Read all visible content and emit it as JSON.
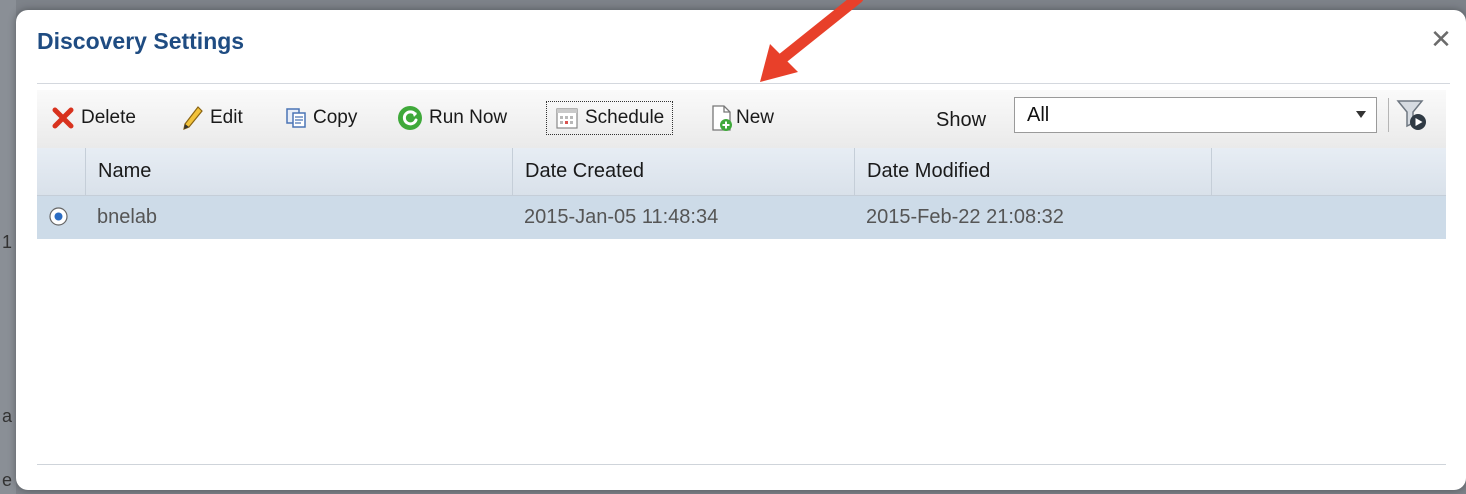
{
  "backdrop": {
    "glyphs": [
      "1",
      "a",
      "e"
    ]
  },
  "dialog": {
    "title": "Discovery Settings",
    "close_icon": "close-icon"
  },
  "toolbar": {
    "delete_label": "Delete",
    "edit_label": "Edit",
    "copy_label": "Copy",
    "run_now_label": "Run Now",
    "schedule_label": "Schedule",
    "new_label": "New",
    "show_label": "Show",
    "show_value": "All",
    "icons": [
      "delete-icon",
      "pencil-icon",
      "copy-icon",
      "refresh-icon",
      "calendar-icon",
      "new-document-icon",
      "filter-icon"
    ]
  },
  "grid": {
    "columns": [
      "Name",
      "Date Created",
      "Date Modified"
    ],
    "rows": [
      {
        "name": "bnelab",
        "date_created": "2015-Jan-05 11:48:34",
        "date_modified": "2015-Feb-22 21:08:32",
        "selected": true
      }
    ]
  },
  "colors": {
    "title": "#1f4c82",
    "annotation_arrow": "#e8402a",
    "row_selected": "#cddbe8",
    "header_bg": "#dde4ec"
  }
}
